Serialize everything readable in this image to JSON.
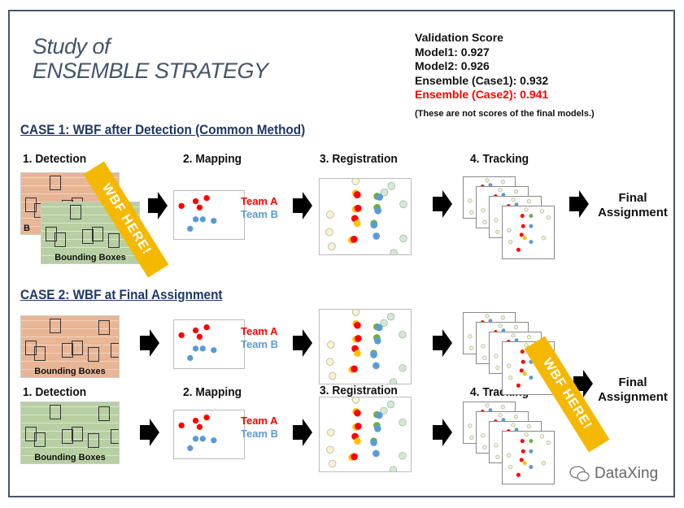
{
  "title": {
    "line1": "Study of",
    "line2": "ENSEMBLE STRATEGY"
  },
  "scores": {
    "heading": "Validation Score",
    "model1": "Model1: 0.927",
    "model2": "Model2: 0.926",
    "case1": "Ensemble (Case1): 0.932",
    "case2": "Ensemble (Case2): 0.941",
    "note": "(These are not scores of the final models.)",
    "highlight_color": "#ff0000"
  },
  "case1": {
    "heading": "CASE 1:  WBF after Detection (Common Method)",
    "steps": [
      "1. Detection",
      "2. Mapping",
      "3. Registration",
      "4. Tracking"
    ],
    "final": [
      "Final",
      "Assignment"
    ],
    "detection_captions": [
      "B",
      "Bounding Boxes"
    ],
    "banner": "WBF HERE!"
  },
  "case2": {
    "heading": "CASE 2:  WBF at Final Assignment",
    "steps": [
      "1. Detection",
      "2. Mapping",
      "3. Registration",
      "4. Tracking"
    ],
    "final": [
      "Final",
      "Assignment"
    ],
    "detection_captions": [
      "Bounding Boxes",
      "Bounding Boxes"
    ],
    "banner": "WBF HERE!"
  },
  "legend": {
    "team_a": "Team A",
    "team_b": "Team B",
    "team_a_color": "#ff0000",
    "team_b_color": "#5b9bd5"
  },
  "watermark": "DataXing"
}
